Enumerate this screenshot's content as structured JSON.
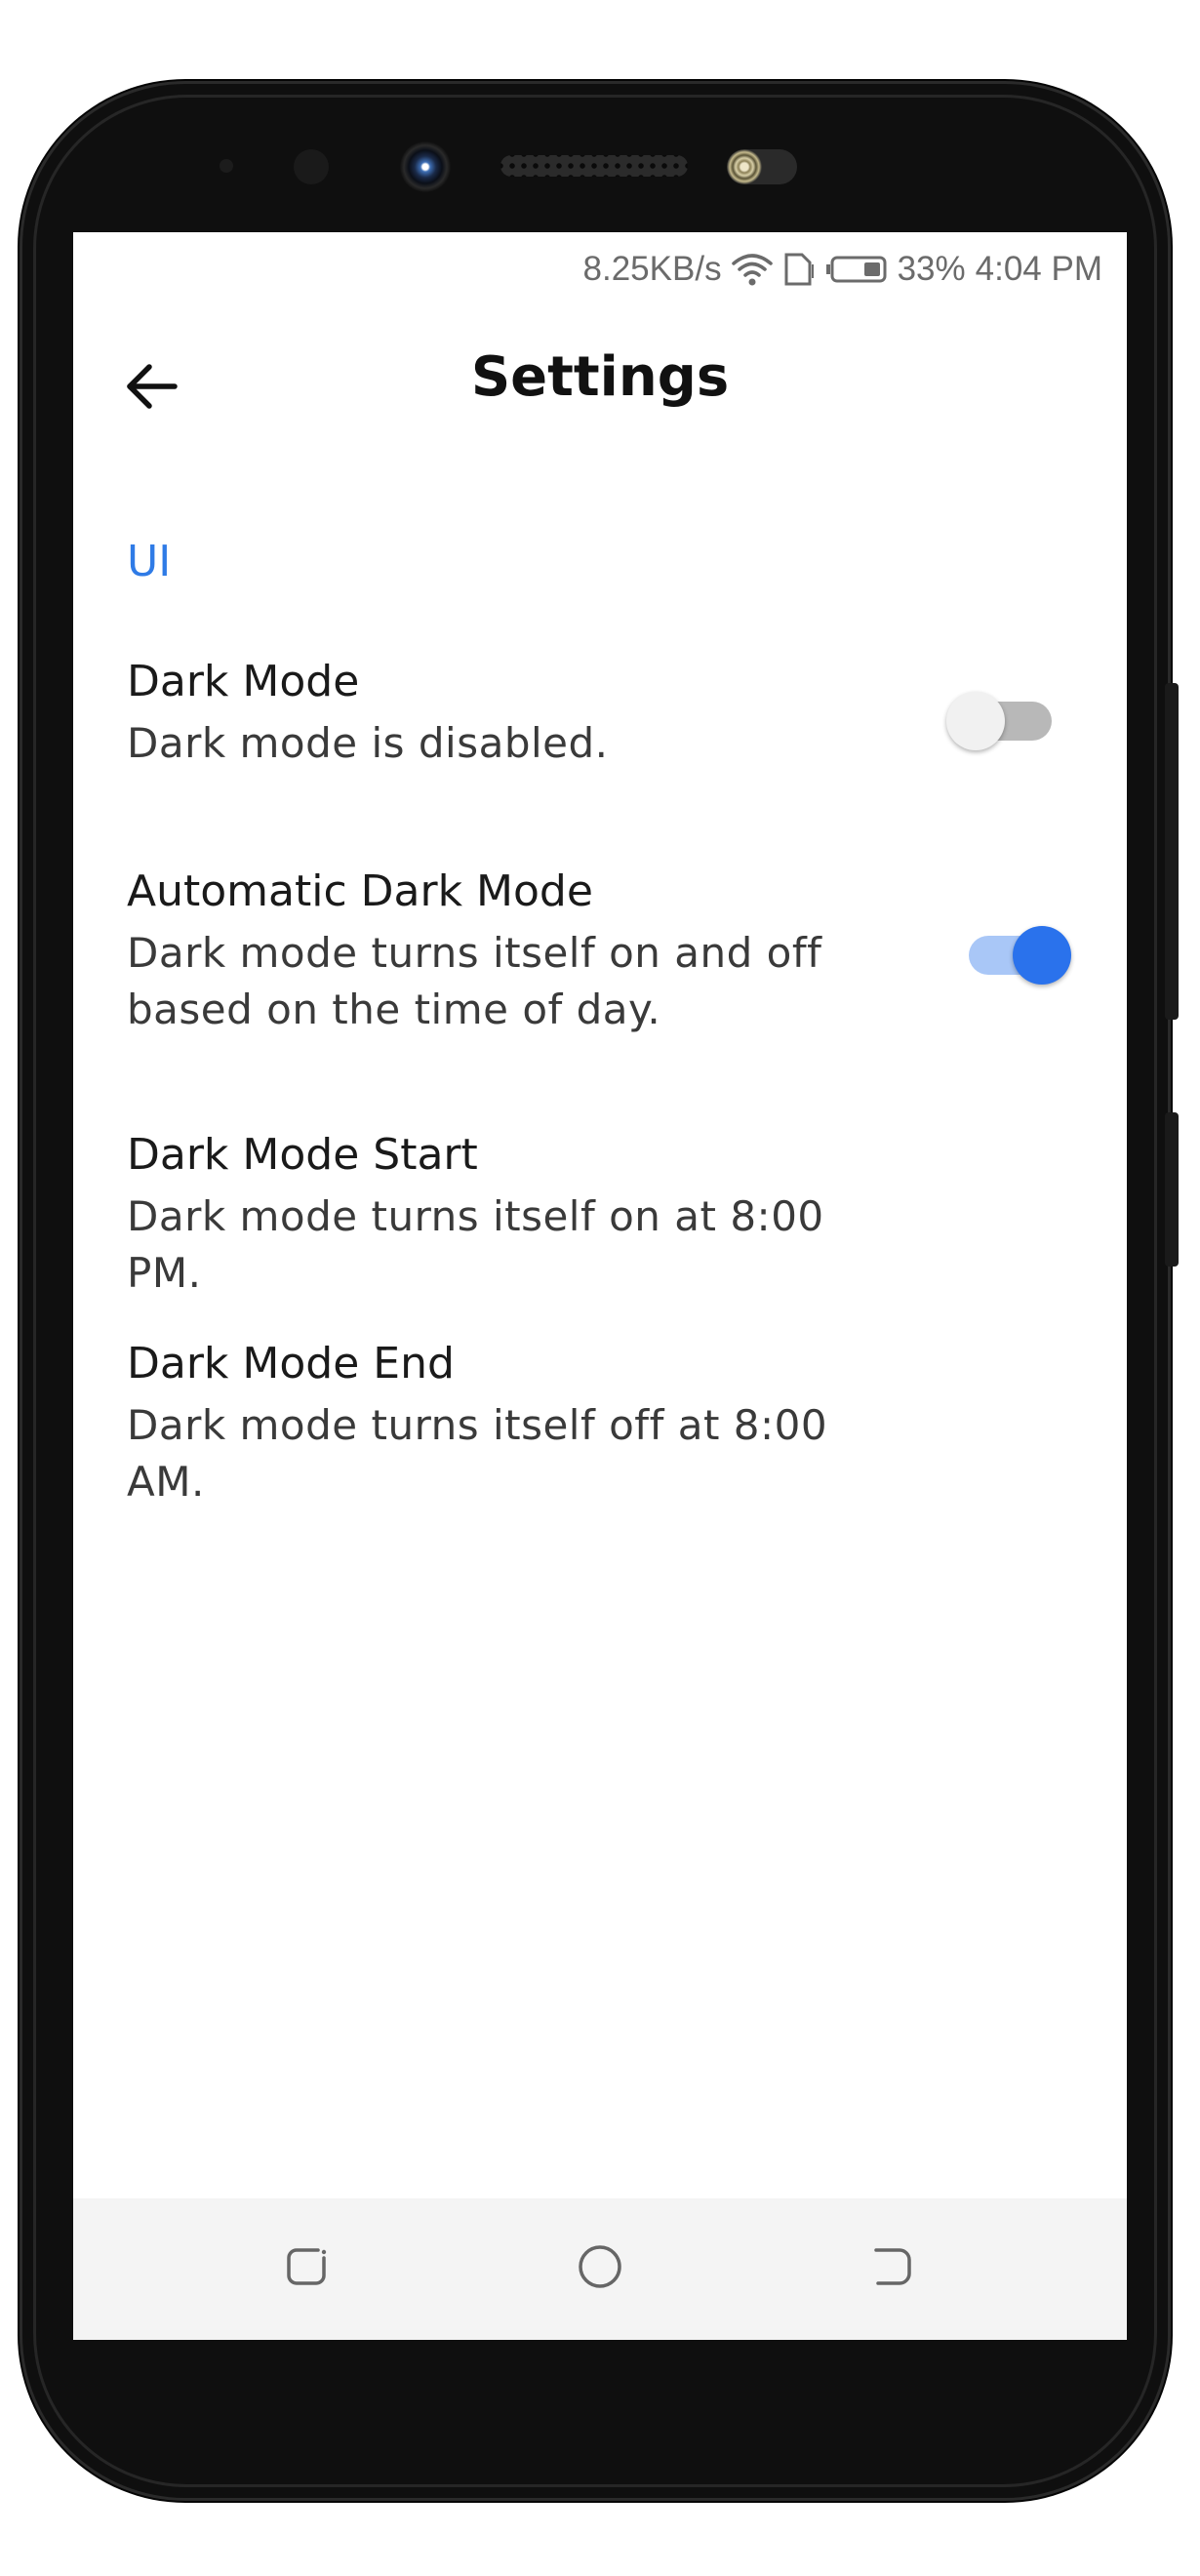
{
  "status_bar": {
    "network_speed": "8.25KB/s",
    "battery_percent": "33%",
    "time": "4:04 PM",
    "icons": [
      "wifi-icon",
      "sim-card-icon",
      "battery-icon"
    ]
  },
  "app_bar": {
    "title": "Settings",
    "back_icon": "arrow-back-icon"
  },
  "section": {
    "header": "UI"
  },
  "preferences": [
    {
      "title": "Dark Mode",
      "summary": "Dark mode is disabled.",
      "switch": "off"
    },
    {
      "title": "Automatic Dark Mode",
      "summary": "Dark mode turns itself on and off based on the time of day.",
      "switch": "on"
    },
    {
      "title": "Dark Mode Start",
      "summary": "Dark mode turns itself on at 8:00 PM."
    },
    {
      "title": "Dark Mode End",
      "summary": "Dark mode turns itself off at 8:00 AM."
    }
  ],
  "nav_bar": {
    "icons": [
      "recent-apps-icon",
      "home-icon",
      "back-icon"
    ]
  },
  "colors": {
    "accent": "#2f7be6",
    "switch_on_thumb": "#2a72ec",
    "switch_on_track": "#a9c7f7",
    "switch_off_thumb": "#f1f1f1",
    "switch_off_track": "#b8b8b8",
    "nav_bar_bg": "#f4f4f4"
  }
}
